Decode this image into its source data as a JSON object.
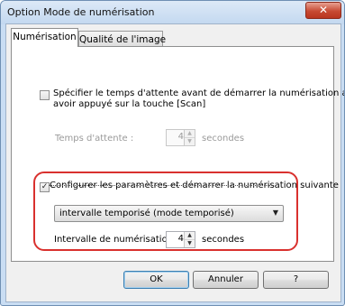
{
  "window": {
    "title": "Option Mode de numérisation",
    "close_glyph": "✕"
  },
  "tabs": [
    {
      "label": "Numérisation"
    },
    {
      "label": "Qualité de l'image"
    }
  ],
  "wait_section": {
    "checkbox_label_line1": "Spécifier le temps d'attente avant de démarrer la numérisation après",
    "checkbox_label_line2": "avoir appuyé sur la touche [Scan]",
    "checked": false,
    "wait_time_label": "Temps d'attente :",
    "wait_time_value": "4",
    "wait_time_unit": "secondes",
    "enabled": false
  },
  "next_scan_section": {
    "checkbox_label": "Configurer les paramètres et démarrer la numérisation suivante",
    "checked": true,
    "mode_value": "intervalle temporisé (mode temporisé)",
    "interval_label": "Intervalle de numérisation :",
    "interval_value": "4",
    "interval_unit": "secondes"
  },
  "buttons": {
    "ok": "OK",
    "cancel": "Annuler",
    "help": "?"
  },
  "colors": {
    "highlight": "#d9312e",
    "title_bar": "#c3d8f0"
  }
}
